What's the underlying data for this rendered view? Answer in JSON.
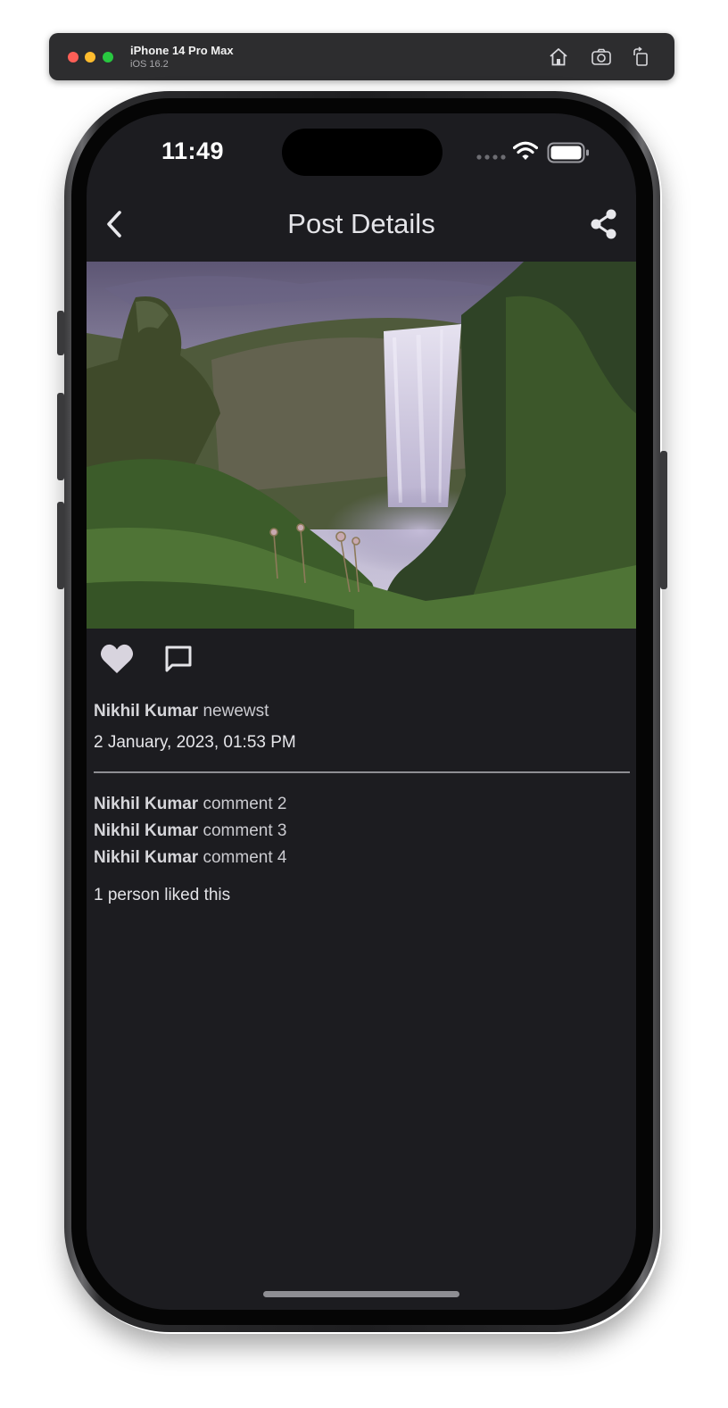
{
  "simulator": {
    "device_name": "iPhone 14 Pro Max",
    "os_version": "iOS 16.2",
    "icons": [
      "home-icon",
      "screenshot-icon",
      "rotate-icon"
    ]
  },
  "status_bar": {
    "time": "11:49",
    "icons": [
      "cellular-icon",
      "wifi-icon",
      "battery-icon"
    ]
  },
  "nav": {
    "title": "Post Details",
    "back_icon": "chevron-left-icon",
    "share_icon": "share-icon"
  },
  "post": {
    "image_description_icon": "waterfall-photo",
    "actions": {
      "like_icon": "heart-icon",
      "comment_icon": "comment-icon"
    },
    "author": "Nikhil Kumar",
    "caption": "newewst",
    "date": "2 January, 2023, 01:53 PM",
    "comments": [
      {
        "author": "Nikhil Kumar",
        "text": "comment 2"
      },
      {
        "author": "Nikhil Kumar",
        "text": "comment 3"
      },
      {
        "author": "Nikhil Kumar",
        "text": "comment 4"
      }
    ],
    "likes_text": "1 person liked this"
  },
  "colors": {
    "screen_bg": "#1c1c20",
    "text_primary": "#e4e4e8",
    "heart_fill": "#d8d4de"
  }
}
